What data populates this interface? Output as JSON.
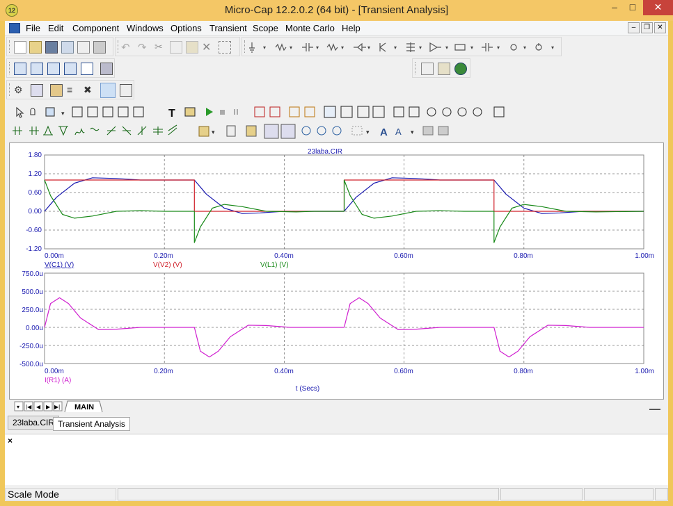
{
  "window": {
    "title": "Micro-Cap 12.2.0.2 (64 bit) - [Transient Analysis]",
    "icon_label": "12"
  },
  "menus": [
    "File",
    "Edit",
    "Component",
    "Windows",
    "Options",
    "Transient",
    "Scope",
    "Monte Carlo",
    "Help"
  ],
  "plot": {
    "title": "23laba.CIR",
    "x_ticks": [
      "0.00m",
      "0.20m",
      "0.40m",
      "0.60m",
      "0.80m",
      "1.00m"
    ],
    "x_ticks2": [
      "0.00m",
      "0.20m",
      "0.40m",
      "0.60m",
      "0.80m",
      "1.00m"
    ],
    "top_y_ticks": [
      "1.80",
      "1.20",
      "0.60",
      "0.00",
      "-0.60",
      "-1.20"
    ],
    "bottom_y_ticks": [
      "750.0u",
      "500.0u",
      "250.0u",
      "0.00u",
      "-250.0u",
      "-500.0u"
    ],
    "legend_top": [
      {
        "label": "V(C1) (V)",
        "color": "#1b1bb0"
      },
      {
        "label": "V(V2) (V)",
        "color": "#d0202a"
      },
      {
        "label": "V(L1) (V)",
        "color": "#1a8a1a"
      }
    ],
    "legend_bottom": [
      {
        "label": "I(R1) (A)",
        "color": "#d020d0"
      }
    ],
    "xlabel": "t (Secs)"
  },
  "chart_data": [
    {
      "type": "line",
      "title": "23laba.CIR",
      "xlabel": "",
      "ylabel": "",
      "xlim": [
        0,
        1.0
      ],
      "ylim": [
        -1.2,
        1.8
      ],
      "x_unit": "ms",
      "grid": true,
      "series": [
        {
          "name": "V(C1) (V)",
          "color": "#1b1bb0",
          "x": [
            0,
            0.02,
            0.05,
            0.08,
            0.12,
            0.16,
            0.2,
            0.25,
            0.27,
            0.3,
            0.33,
            0.36,
            0.4,
            0.45,
            0.5,
            0.52,
            0.55,
            0.58,
            0.62,
            0.66,
            0.7,
            0.75,
            0.77,
            0.8,
            0.83,
            0.86,
            0.9,
            0.95,
            1.0
          ],
          "y": [
            0,
            0.45,
            0.9,
            1.07,
            1.05,
            1.0,
            1.0,
            1.0,
            0.55,
            0.1,
            -0.07,
            -0.05,
            0.0,
            0.0,
            0.0,
            0.45,
            0.9,
            1.07,
            1.05,
            1.0,
            1.0,
            1.0,
            0.55,
            0.1,
            -0.07,
            -0.05,
            0.0,
            0.0,
            0.0
          ]
        },
        {
          "name": "V(V2) (V)",
          "color": "#d0202a",
          "x": [
            0,
            0.25,
            0.25,
            0.5,
            0.5,
            0.75,
            0.75,
            1.0
          ],
          "y": [
            1.0,
            1.0,
            0.0,
            0.0,
            1.0,
            1.0,
            0.0,
            0.0
          ]
        },
        {
          "name": "V(L1) (V)",
          "color": "#1a8a1a",
          "x": [
            0,
            0.01,
            0.03,
            0.05,
            0.08,
            0.12,
            0.16,
            0.2,
            0.25,
            0.25,
            0.26,
            0.28,
            0.3,
            0.33,
            0.37,
            0.42,
            0.45,
            0.5,
            0.5,
            0.51,
            0.53,
            0.55,
            0.58,
            0.62,
            0.66,
            0.7,
            0.75,
            0.75,
            0.76,
            0.78,
            0.8,
            0.83,
            0.87,
            0.92,
            1.0
          ],
          "y": [
            1.0,
            0.5,
            -0.1,
            -0.22,
            -0.15,
            0.0,
            0.02,
            0.0,
            0.0,
            -1.0,
            -0.5,
            0.1,
            0.22,
            0.15,
            0.0,
            -0.02,
            0.0,
            0.0,
            1.0,
            0.5,
            -0.1,
            -0.22,
            -0.15,
            0.0,
            0.02,
            0.0,
            0.0,
            -1.0,
            -0.5,
            0.1,
            0.22,
            0.15,
            0.0,
            -0.02,
            0.0
          ]
        }
      ]
    },
    {
      "type": "line",
      "xlabel": "t (Secs)",
      "ylabel": "",
      "xlim": [
        0,
        1.0
      ],
      "ylim": [
        -500,
        750
      ],
      "y_unit": "uA",
      "grid": true,
      "series": [
        {
          "name": "I(R1) (A)",
          "color": "#d020d0",
          "x": [
            0,
            0.01,
            0.025,
            0.04,
            0.06,
            0.09,
            0.12,
            0.16,
            0.2,
            0.25,
            0.26,
            0.275,
            0.29,
            0.31,
            0.34,
            0.37,
            0.41,
            0.45,
            0.5,
            0.51,
            0.525,
            0.54,
            0.56,
            0.59,
            0.62,
            0.66,
            0.7,
            0.75,
            0.76,
            0.775,
            0.79,
            0.81,
            0.84,
            0.87,
            0.91,
            0.95,
            1.0
          ],
          "y": [
            0,
            330,
            410,
            330,
            130,
            -30,
            -25,
            0,
            0,
            0,
            -330,
            -410,
            -330,
            -130,
            30,
            25,
            0,
            0,
            0,
            330,
            410,
            330,
            130,
            -30,
            -25,
            0,
            0,
            0,
            -330,
            -410,
            -330,
            -130,
            30,
            25,
            0,
            0,
            0
          ]
        }
      ]
    }
  ],
  "sheet_tab": "MAIN",
  "doc_tabs": [
    "23laba.CIR",
    "Transient Analysis"
  ],
  "output_close": "×",
  "status": {
    "mode": "Scale Mode"
  }
}
